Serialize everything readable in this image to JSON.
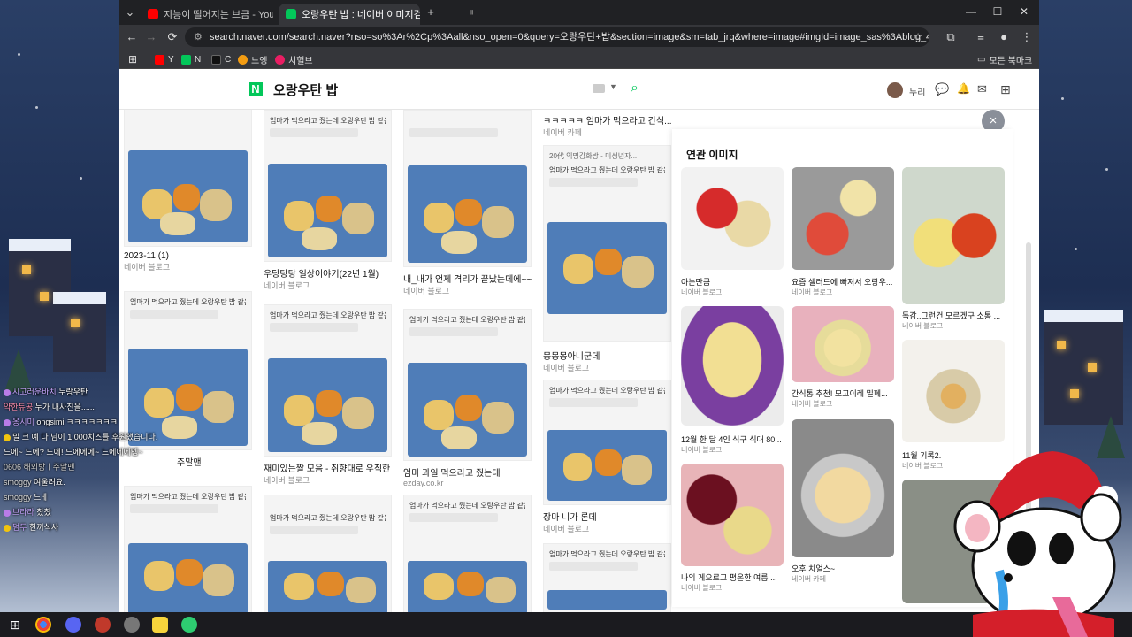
{
  "browser": {
    "tabs": [
      {
        "label": "지능이 떨어지는 브금 - YouTube",
        "active": false,
        "color": "#ff0000"
      },
      {
        "label": "오랑우탄 밥 : 네이버 이미지검색",
        "active": true,
        "color": "#03c75a"
      }
    ],
    "new_tab": "+",
    "url": "search.naver.com/search.naver?nso=so%3Ar%2Cp%3Aall&nso_open=0&query=오랑우탄+밥&section=image&sm=tab_jrq&where=image#imgId=image_sas%3Ablog_4a9d16253dea88b...",
    "bookmarks": [
      {
        "label": "Y",
        "color": "#ff0000"
      },
      {
        "label": "N",
        "color": "#03c75a"
      },
      {
        "label": "C",
        "color": "#111111"
      },
      {
        "label": "느엥",
        "color": "#f39c12"
      },
      {
        "label": "치헐브",
        "color": "#e91e63"
      }
    ],
    "all_bookmarks": "모든 북마크"
  },
  "naver": {
    "logo": "N",
    "query": "오랑우탄 밥",
    "user": "누리",
    "accent": "#03c75a"
  },
  "grid": {
    "post_title": "엄마가 먹으라고 줬는데 오랑우탄 밥 같음",
    "items": [
      {
        "caption": "2023-11 (1)",
        "source": "네이버 블로그"
      },
      {
        "caption": "우당탕탕 일상이야기(22년 1월)",
        "source": "네이버 블로그"
      },
      {
        "caption": "내_내가 언제 격리가 끝났는데에~~...",
        "source": "네이버 블로그"
      },
      {
        "caption": "ㅋㅋㅋㅋㅋ 엄마가 먹으라고 간식...",
        "source": "네이버 카페"
      },
      {
        "caption": "주말맨",
        "source": ""
      },
      {
        "caption": "재미있는짤 모음 - 취향대로 우직한 ...",
        "source": "네이버 블로그"
      },
      {
        "caption": "엄마 과일 먹으라고 줬는데",
        "source": "ezday.co.kr"
      },
      {
        "caption": "몽몽몽아니군데",
        "source": "네이버 블로그"
      },
      {
        "caption": "장마 니가 론데",
        "source": "네이버 블로그"
      }
    ],
    "tabpost_header": "20代 익명감화방 - 미성년자..."
  },
  "related": {
    "title": "연관 이미지",
    "close": "×",
    "items": [
      {
        "caption": "아는만큼",
        "source": "네이버 블로그"
      },
      {
        "caption": "요즘 샐러드에 빠져서 오랑우...",
        "source": "네이버 블로그"
      },
      {
        "caption": "독감..그런건 모르겠구 소통 ...",
        "source": "네이버 블로그"
      },
      {
        "caption": "12월 한 달 4인 식구 식대 80...",
        "source": "네이버 블로그"
      },
      {
        "caption": "간식통 추천! 모고이레 밀폐...",
        "source": "네이버 블로그"
      },
      {
        "caption": "11월 기록2.",
        "source": "네이버 블로그"
      },
      {
        "caption": "나의 게으르고 평온한 여름 ...",
        "source": "네이버 블로그"
      },
      {
        "caption": "오후 치얼스~",
        "source": "네이버 카페"
      }
    ]
  },
  "chat": [
    {
      "nick": "시고러운바치",
      "text": "누랑우탄"
    },
    {
      "nick": "약한듀공",
      "text": "누가 내사진을......"
    },
    {
      "nick": "옹시미",
      "text": "ongsimi ㅋㅋㅋㅋㅋㅋㅋ"
    },
    {
      "nick": "밀 크 예 다",
      "text": "님이 1,000치즈를 후원했습니다."
    },
    {
      "nick": "",
      "text": "느에~ 느에? 느에! 느에에에~ 느에에에엥~"
    },
    {
      "nick": "smoggy",
      "text": "여울려요."
    },
    {
      "nick": "smoggy",
      "text": "느ㅔ"
    },
    {
      "nick": "브라라",
      "text": "찼찼"
    },
    {
      "nick": "덤두",
      "text": "한끼식사"
    }
  ],
  "overlay_text": "0606 해외방ㅣ주말맨"
}
